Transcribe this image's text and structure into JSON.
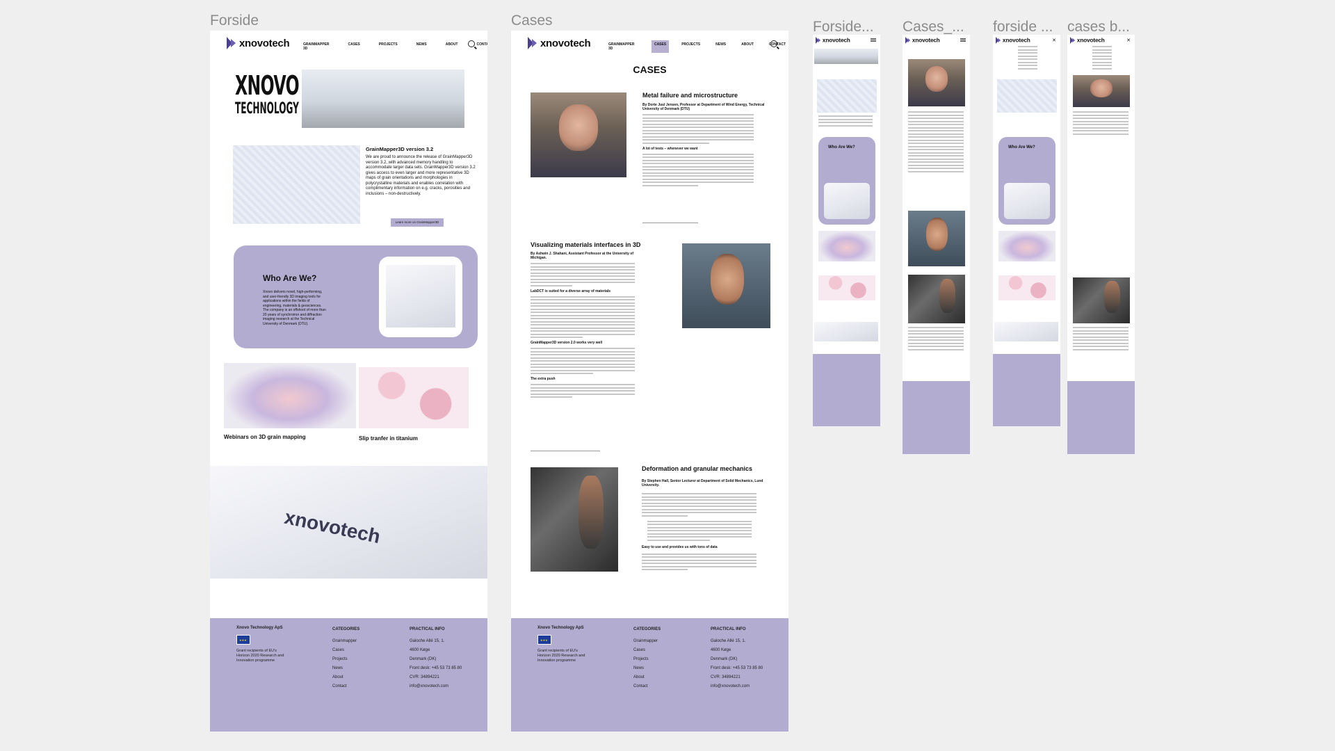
{
  "frames": {
    "forside": "Forside",
    "cases": "Cases",
    "m1": "Forside...",
    "m2": "Cases_...",
    "m3": "forside ...",
    "m4": "cases b..."
  },
  "brand": {
    "logo": "xnovotech",
    "accent": "#b3acd1"
  },
  "nav": {
    "items": [
      "GRAINMAPPER 3D",
      "CASES",
      "PROJECTS",
      "NEWS",
      "ABOUT",
      "CONTACT"
    ]
  },
  "forside": {
    "hero_word1": "XNOVO",
    "hero_word2": "TECHNOLOGY",
    "gm_title": "GrainMapper3D version 3.2",
    "gm_body": "We are proud to announce the release of GrainMapper3D version 3.2, with advanced memory handling to accommodate larger data sets. GrainMapper3D version 3.2 gives access to even larger and more representative 3D maps of grain orientations and morphologies in polycrystalline materials and enables correlation with complimentary information on e.g. cracks, porosities and inclusions – non-destructively.",
    "gm_button": "Learn more on GrainMapper3D",
    "who_title": "Who Are We?",
    "who_body": "Xnovo delivers novel, high-performing, and user-friendly 3D imaging tools for applications within the fields of engineering, materials & geosciences. The company is an offshoot of more than 20 years of synchrotron and diffraction imaging research at the Technical University of Denmark (DTU).",
    "card1": "Webinars on 3D grain mapping",
    "card2": "Slip tranfer in titanium"
  },
  "cases": {
    "page_title": "CASES",
    "c1_title": "Metal failure and microstructure",
    "c1_author": "By Dorte Juul Jensen, Professor at Department of Wind Energy, Technical University of Denmark (DTU)",
    "c1_sub": "A lot of tests – whenever we want",
    "c2_title": "Visualizing materials interfaces in 3D",
    "c2_author": "By Ashwin J. Shahani, Assistant Professor at the University of Michigan.",
    "c2_sub1": "LabDCT is suited for a diverse array of materials",
    "c2_sub2": "GrainMapper3D version 2.0 works very well",
    "c2_sub3": "The extra push",
    "c3_title": "Deformation and granular mechanics",
    "c3_author": "By Stephen Hall, Senior Lecturer at Department of Solid Mechanics, Lund University.",
    "c3_sub": "Easy to use and provides us with tons of data"
  },
  "footer": {
    "company": "Xnovo Technology ApS",
    "grant": "Grant recipients of EU's Horizon 2020 Research and Innovation programme",
    "categories_title": "CATEGORIES",
    "categories": [
      "Grainmapper",
      "Cases",
      "Projects",
      "News",
      "About",
      "Contact"
    ],
    "info_title": "PRACTICAL INFO",
    "info": [
      "Galoche Allé 15, 1.",
      "4600 Køge",
      "Denmark (DK)",
      "Front desk: +45 53 73 85 80",
      "CVR: 34894221",
      "info@xnovotech.com"
    ]
  },
  "mobile": {
    "who_title": "Who Are We?"
  }
}
